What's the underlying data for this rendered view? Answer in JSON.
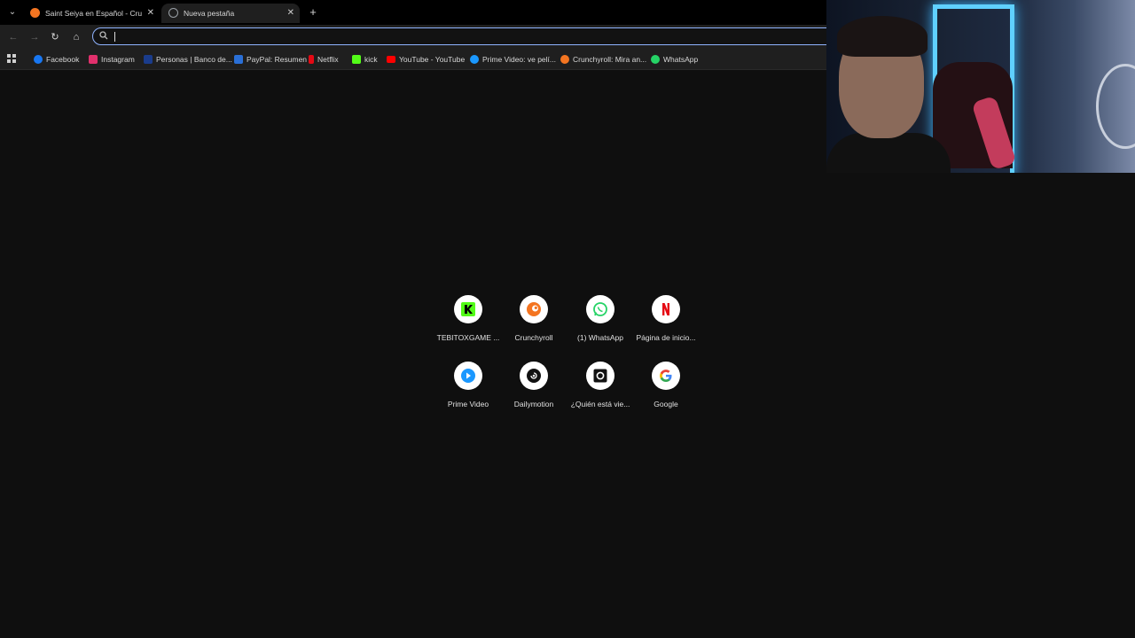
{
  "tabs": [
    {
      "title": "Saint Seiya en Español - Crunchyroll",
      "favicon": "crunchyroll-icon",
      "color": "#f47521",
      "active": false
    },
    {
      "title": "Nueva pestaña",
      "favicon": "globe-icon",
      "color": "#9aa0a6",
      "active": true
    }
  ],
  "omnibox": {
    "value": "",
    "placeholder": ""
  },
  "bookmarks": [
    {
      "label": "Facebook",
      "icon": "facebook-icon",
      "color": "#1877f2"
    },
    {
      "label": "Instagram",
      "icon": "instagram-icon",
      "color": "#e1306c"
    },
    {
      "label": "Personas | Banco de...",
      "icon": "bank-icon",
      "color": "#1a3c8c"
    },
    {
      "label": "PayPal: Resumen",
      "icon": "paypal-icon",
      "color": "#2a6fd6"
    },
    {
      "label": "Netflix",
      "icon": "netflix-icon",
      "color": "#e50914"
    },
    {
      "label": "kick",
      "icon": "kick-icon",
      "color": "#53fc18"
    },
    {
      "label": "YouTube - YouTube",
      "icon": "youtube-icon",
      "color": "#ff0000"
    },
    {
      "label": "Prime Video: ve pelí...",
      "icon": "prime-video-icon",
      "color": "#1a98ff"
    },
    {
      "label": "Crunchyroll: Mira an...",
      "icon": "crunchyroll-icon",
      "color": "#f47521"
    },
    {
      "label": "WhatsApp",
      "icon": "whatsapp-icon",
      "color": "#25d366"
    }
  ],
  "shortcuts": [
    {
      "label": "TEBITOXGAME ...",
      "icon": "kick-icon",
      "color": "#53fc18"
    },
    {
      "label": "Crunchyroll",
      "icon": "crunchyroll-icon",
      "color": "#f47521"
    },
    {
      "label": "(1) WhatsApp",
      "icon": "whatsapp-icon",
      "color": "#25d366"
    },
    {
      "label": "Página de inicio...",
      "icon": "netflix-icon",
      "color": "#e50914"
    },
    {
      "label": "Prime Video",
      "icon": "prime-video-icon",
      "color": "#1a98ff"
    },
    {
      "label": "Dailymotion",
      "icon": "dailymotion-icon",
      "color": "#111111"
    },
    {
      "label": "¿Quién está vie...",
      "icon": "camera-icon",
      "color": "#111111"
    },
    {
      "label": "Google",
      "icon": "google-icon",
      "color": "#4285f4"
    }
  ]
}
